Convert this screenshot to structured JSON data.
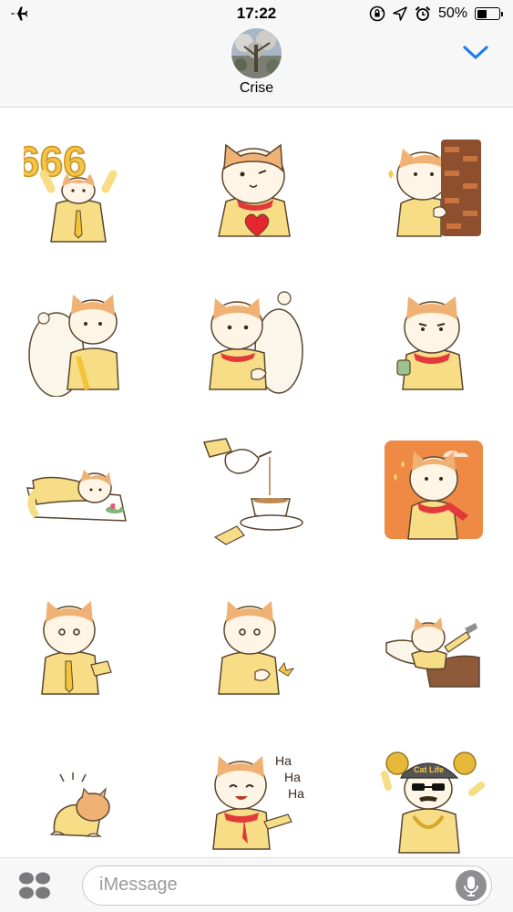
{
  "status_bar": {
    "time": "17:22",
    "battery_percent": "50%",
    "battery_level": 0.5,
    "icons": [
      "airplane-icon",
      "orientation-lock-icon",
      "location-icon",
      "alarm-icon",
      "battery-icon"
    ]
  },
  "header": {
    "contact_name": "Crise",
    "collapse_icon": "chevron-down-icon",
    "accent_color": "#1e7cf2"
  },
  "stickers": {
    "count": 15,
    "items": [
      {
        "name": "sticker-666-cheer",
        "text": "666"
      },
      {
        "name": "sticker-wink-heart"
      },
      {
        "name": "sticker-peek-wall"
      },
      {
        "name": "sticker-hug-bear"
      },
      {
        "name": "sticker-bear-behind"
      },
      {
        "name": "sticker-drink-tea"
      },
      {
        "name": "sticker-lying-down"
      },
      {
        "name": "sticker-pour-tea"
      },
      {
        "name": "sticker-orange-pose"
      },
      {
        "name": "sticker-reach-hand"
      },
      {
        "name": "sticker-clap"
      },
      {
        "name": "sticker-lounge"
      },
      {
        "name": "sticker-crouch"
      },
      {
        "name": "sticker-haha-point",
        "text": [
          "Ha",
          "Ha",
          "Ha"
        ]
      },
      {
        "name": "sticker-gangster",
        "cap_text": "Cat Life"
      }
    ]
  },
  "composer": {
    "placeholder": "iMessage",
    "apps_icon": "app-drawer-icon",
    "mic_icon": "microphone-icon"
  }
}
